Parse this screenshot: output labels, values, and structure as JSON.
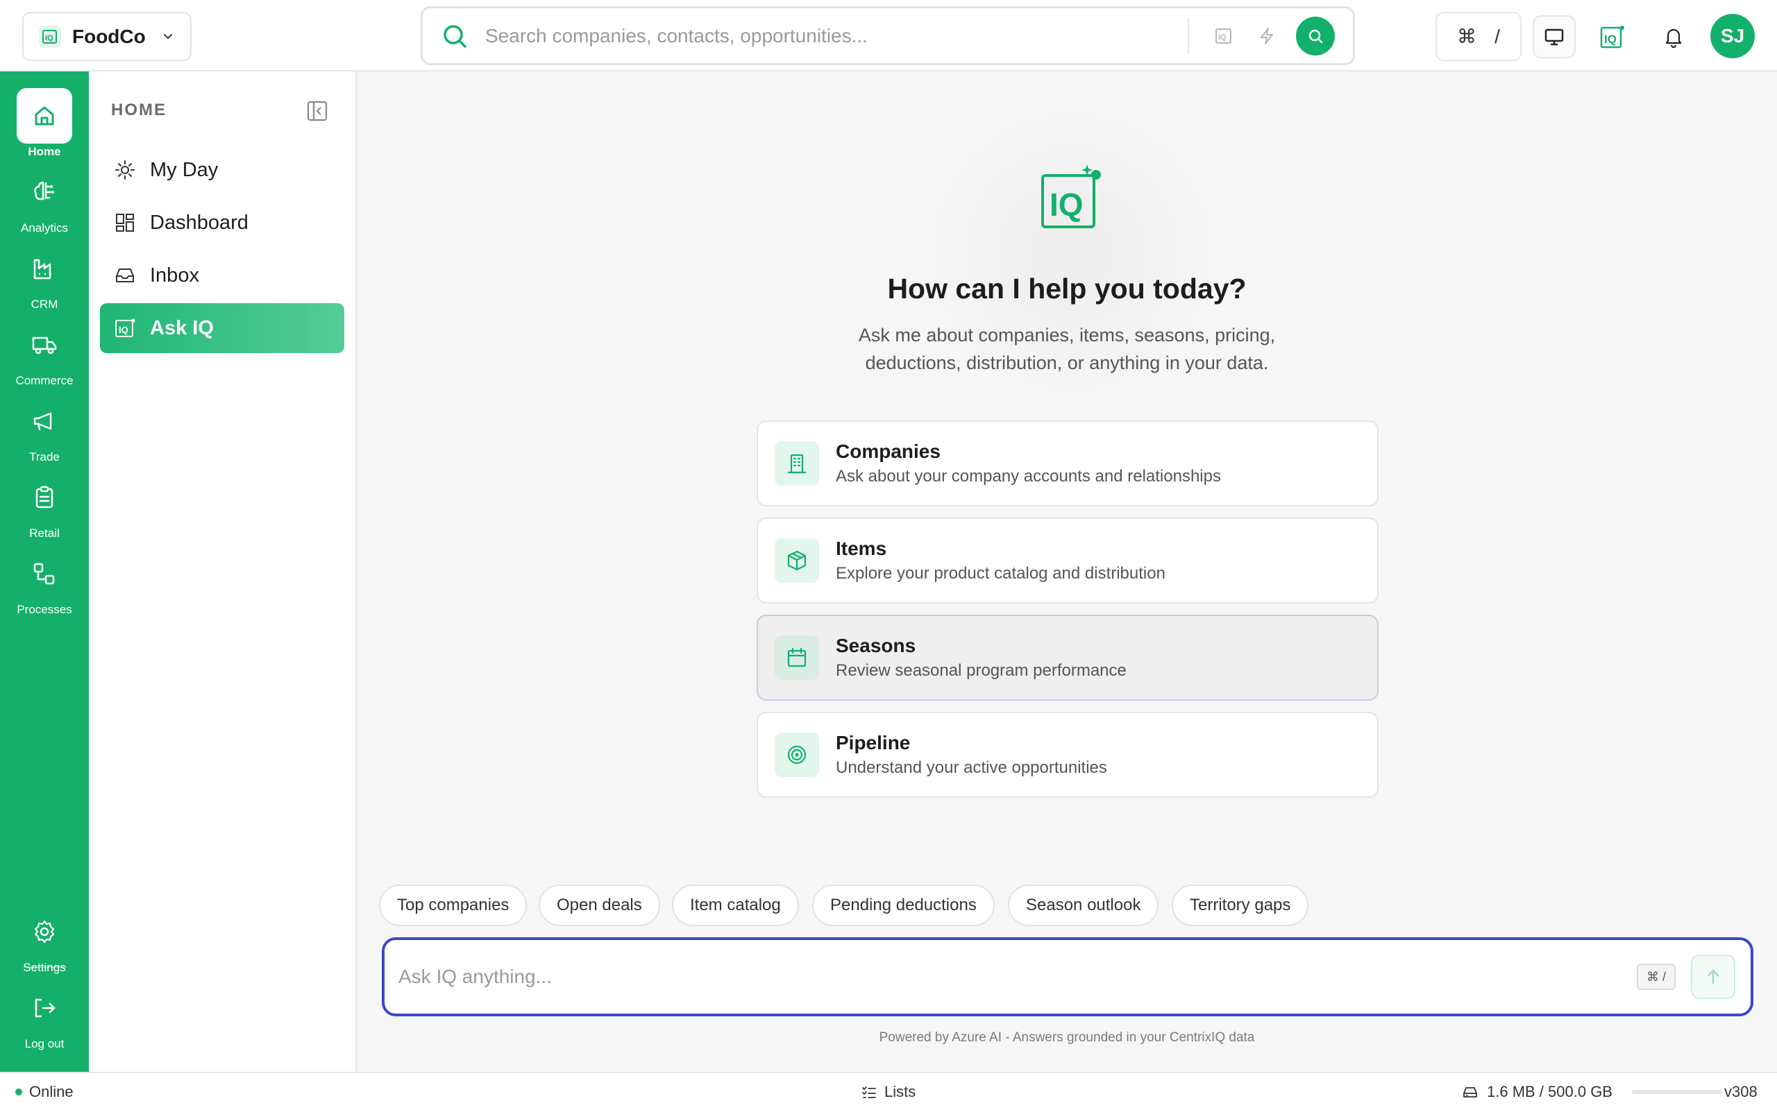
{
  "org": {
    "name": "FoodCo"
  },
  "search": {
    "placeholder": "Search companies, contacts, opportunities..."
  },
  "shortcut": {
    "cmd": "⌘",
    "key": "/"
  },
  "user": {
    "initials": "SJ"
  },
  "rail": {
    "items": [
      {
        "label": "Home"
      },
      {
        "label": "Analytics"
      },
      {
        "label": "CRM"
      },
      {
        "label": "Commerce"
      },
      {
        "label": "Trade"
      },
      {
        "label": "Retail"
      },
      {
        "label": "Processes"
      }
    ],
    "settings": "Settings",
    "logout": "Log out"
  },
  "sidebar": {
    "heading": "HOME",
    "items": [
      {
        "label": "My Day"
      },
      {
        "label": "Dashboard"
      },
      {
        "label": "Inbox"
      },
      {
        "label": "Ask IQ"
      }
    ]
  },
  "hero": {
    "title": "How can I help you today?",
    "subtitle": "Ask me about companies, items, seasons, pricing, deductions, distribution, or anything in your data."
  },
  "cards": [
    {
      "title": "Companies",
      "desc": "Ask about your company accounts and relationships"
    },
    {
      "title": "Items",
      "desc": "Explore your product catalog and distribution"
    },
    {
      "title": "Seasons",
      "desc": "Review seasonal program performance"
    },
    {
      "title": "Pipeline",
      "desc": "Understand your active opportunities"
    }
  ],
  "chips": [
    "Top companies",
    "Open deals",
    "Item catalog",
    "Pending deductions",
    "Season outlook",
    "Territory gaps"
  ],
  "ask": {
    "placeholder": "Ask IQ anything...",
    "kbd": "⌘ /"
  },
  "powered": "Powered by Azure AI - Answers grounded in your CentrixIQ data",
  "status": {
    "online": "Online",
    "lists": "Lists",
    "storage": "1.6 MB / 500.0 GB",
    "storage_fraction": 3.2e-06,
    "version": "v308"
  },
  "colors": {
    "accent": "#12b06b",
    "focus": "#3b47c9"
  }
}
